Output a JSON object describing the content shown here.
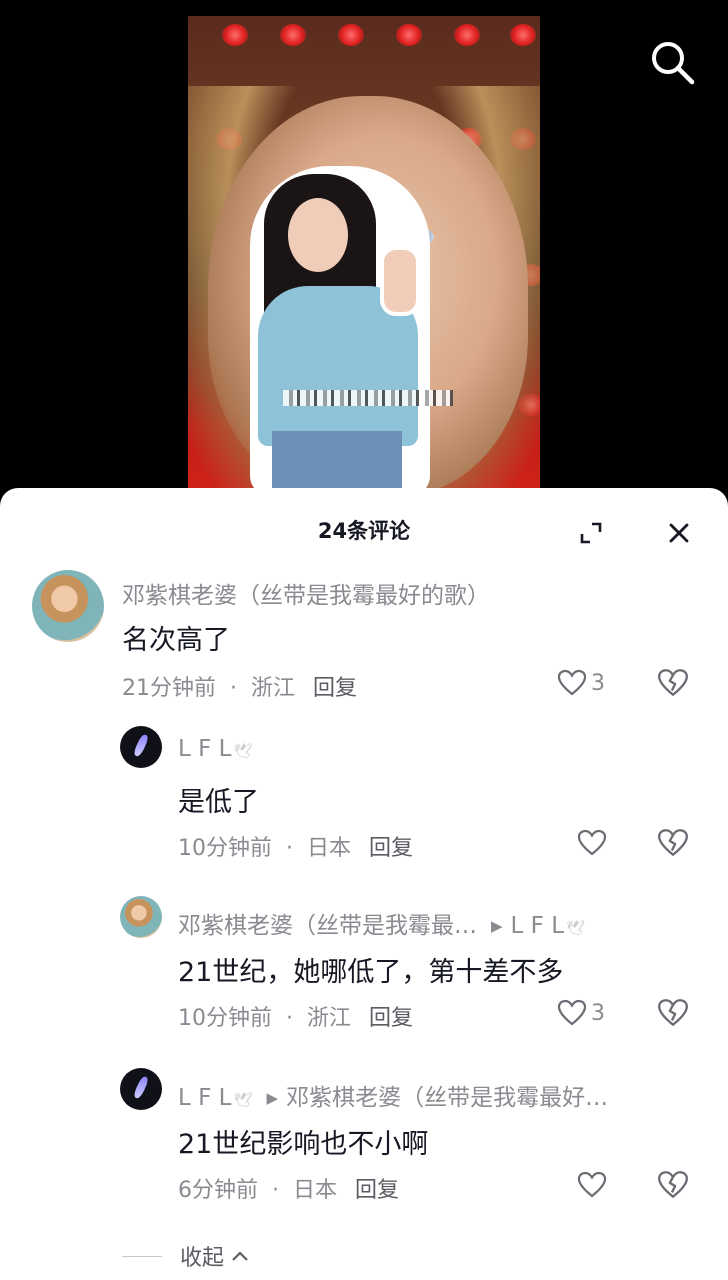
{
  "sheet": {
    "title": "24条评论"
  },
  "comments": [
    {
      "author": "邓紫棋老婆（丝带是我霉最好的歌）",
      "text": "名次高了",
      "time": "21分钟前",
      "location": "浙江",
      "reply_label": "回复",
      "likes": "3",
      "avatar": "girl-avatar"
    },
    {
      "author": "L F L",
      "text": "是低了",
      "time": "10分钟前",
      "location": "日本",
      "reply_label": "回复",
      "likes": "",
      "avatar": "dark-avatar"
    },
    {
      "author": "邓紫棋老婆（丝带是我霉最…",
      "reply_to": "L F L",
      "text": "21世纪，她哪低了，第十差不多",
      "time": "10分钟前",
      "location": "浙江",
      "reply_label": "回复",
      "likes": "3",
      "avatar": "girl-avatar"
    },
    {
      "author": "L F L",
      "reply_to": "邓紫棋老婆（丝带是我霉最好…",
      "text": "21世纪影响也不小啊",
      "time": "6分钟前",
      "location": "日本",
      "reply_label": "回复",
      "likes": "",
      "avatar": "dark-avatar"
    }
  ],
  "collapse_label": "收起",
  "icons": {
    "search": "search-icon",
    "expand": "expand-icon",
    "close": "close-icon",
    "like": "heart-icon",
    "dislike": "broken-heart-icon"
  }
}
